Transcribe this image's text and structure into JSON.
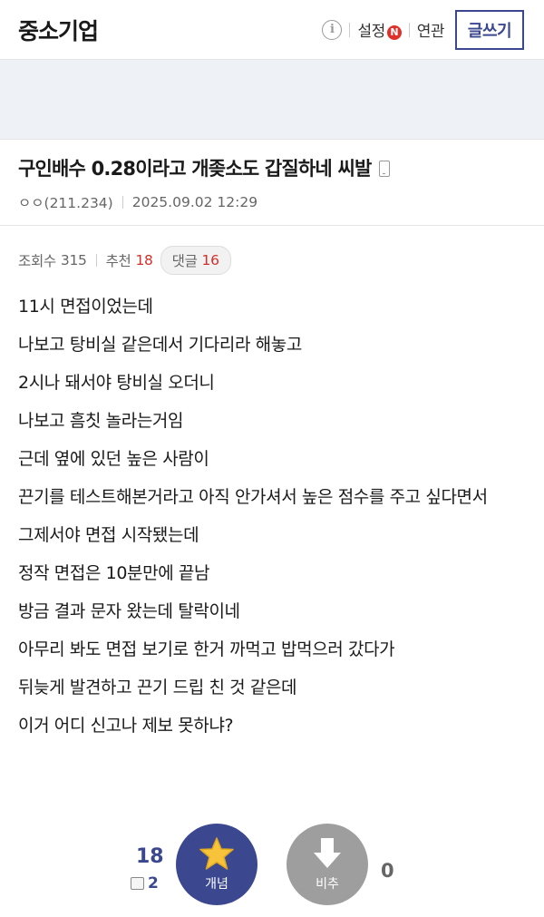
{
  "header": {
    "gallery_title": "중소기업",
    "info_icon": "i",
    "settings_label": "설정",
    "new_badge": "N",
    "related_label": "연관",
    "write_label": "글쓰기"
  },
  "post": {
    "title": "구인배수 0.28이라고 개좆소도 갑질하네 씨발",
    "author": "ㅇㅇ(211.234)",
    "date": "2025.09.02 12:29",
    "views_label": "조회수",
    "views": "315",
    "recommend_label": "추천",
    "recommend": "18",
    "comments_label": "댓글",
    "comments": "16"
  },
  "content": {
    "lines": [
      "11시 면접이었는데",
      "나보고 탕비실 같은데서 기다리라 해놓고",
      "2시나 돼서야 탕비실 오더니",
      "나보고 흠칫 놀라는거임",
      "근데 옆에 있던 높은 사람이",
      "끈기를 테스트해본거라고 아직 안가셔서 높은 점수를 주고 싶다면서",
      "그제서야 면접 시작됐는데",
      "정작 면접은 10분만에 끝남",
      "방금 결과 문자 왔는데 탈락이네",
      "아무리 봐도 면접 보기로 한거 까먹고 밥먹으러 갔다가",
      "뒤늦게 발견하고 끈기 드립 친 것 같은데",
      "이거 어디 신고나 제보 못하냐?"
    ]
  },
  "vote": {
    "up_count": "18",
    "fix_count": "2",
    "up_label": "개념",
    "down_label": "비추",
    "down_count": "0",
    "up_color": "#3b4890",
    "down_color": "#9e9e9e"
  }
}
